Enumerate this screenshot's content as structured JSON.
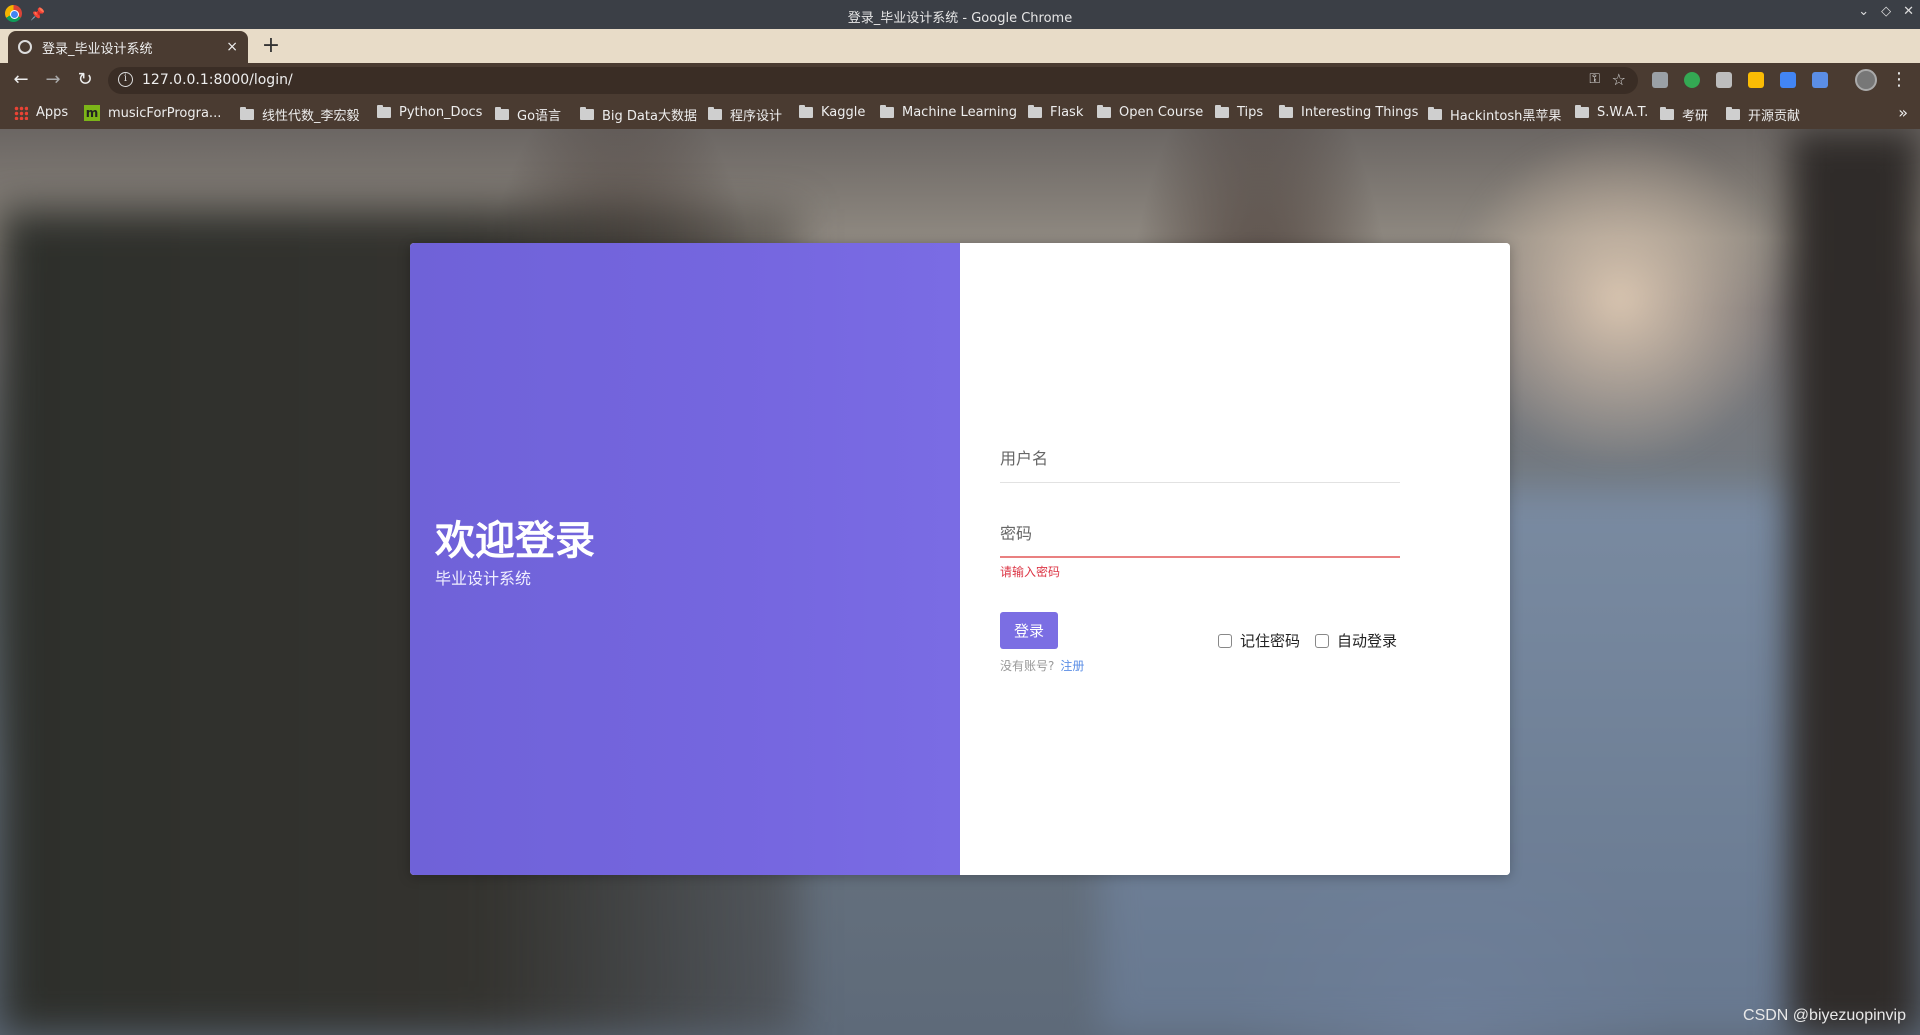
{
  "window": {
    "title": "登录_毕业设计系统 - Google Chrome",
    "controls": [
      "⌄",
      "◇",
      "✕"
    ]
  },
  "tab": {
    "title": "登录_毕业设计系统",
    "close": "×",
    "new_tab": "+"
  },
  "toolbar": {
    "back": "←",
    "forward": "→",
    "reload": "↻",
    "url": "127.0.0.1:8000/login/",
    "info_icon": "i",
    "key_icon": "⚿",
    "star_icon": "☆",
    "menu_icon": "⋮"
  },
  "bookmarks": {
    "items": [
      {
        "label": "Apps",
        "icon": "apps-grid"
      },
      {
        "label": "musicForProgra...",
        "icon": "m"
      },
      {
        "label": "线性代数_李宏毅",
        "icon": "folder"
      },
      {
        "label": "Python_Docs",
        "icon": "folder"
      },
      {
        "label": "Go语言",
        "icon": "folder"
      },
      {
        "label": "Big Data大数据",
        "icon": "folder"
      },
      {
        "label": "程序设计",
        "icon": "folder"
      },
      {
        "label": "Kaggle",
        "icon": "folder"
      },
      {
        "label": "Machine Learning",
        "icon": "folder"
      },
      {
        "label": "Flask",
        "icon": "folder"
      },
      {
        "label": "Open Course",
        "icon": "folder"
      },
      {
        "label": "Tips",
        "icon": "folder"
      },
      {
        "label": "Interesting Things",
        "icon": "folder"
      },
      {
        "label": "Hackintosh黑苹果",
        "icon": "folder"
      },
      {
        "label": "S.W.A.T.",
        "icon": "folder"
      },
      {
        "label": "考研",
        "icon": "folder"
      },
      {
        "label": "开源贡献",
        "icon": "folder"
      }
    ],
    "more": "»"
  },
  "login": {
    "welcome": "欢迎登录",
    "subtitle": "毕业设计系统",
    "username_placeholder": "用户名",
    "password_placeholder": "密码",
    "password_error": "请输入密码",
    "login_button": "登录",
    "remember_password": "记住密码",
    "auto_login": "自动登录",
    "no_account": "没有账号?",
    "register": "注册"
  },
  "colors": {
    "accent": "#7b6ee3",
    "error": "#dc3545",
    "link": "#5b8ee6"
  },
  "watermark": "CSDN @biyezuopinvip"
}
